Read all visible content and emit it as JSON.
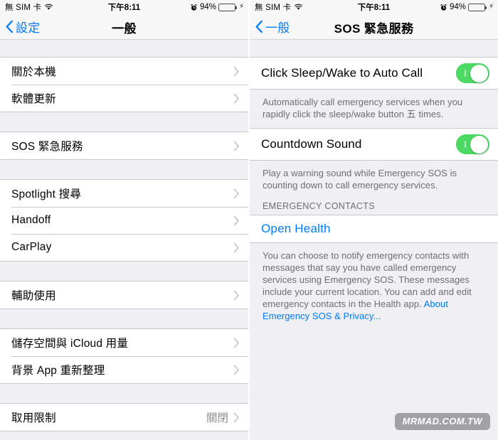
{
  "status_bar": {
    "carrier": "無 SIM 卡",
    "wifi_icon": "wifi-icon",
    "time": "下午8:11",
    "alarm_icon": "alarm-clock-icon",
    "battery_percent": "94%",
    "battery_level": 94,
    "charging_icon": "lightning-bolt-icon",
    "battery_color": "#4cd964"
  },
  "left_screen": {
    "nav": {
      "back_icon": "chevron-left-icon",
      "back_label": "設定",
      "title": "一般"
    },
    "groups": [
      {
        "rows": [
          {
            "label": "關於本機",
            "value": "",
            "accessory": "chevron-right-icon"
          },
          {
            "label": "軟體更新",
            "value": "",
            "accessory": "chevron-right-icon"
          }
        ]
      },
      {
        "rows": [
          {
            "label": "SOS 緊急服務",
            "value": "",
            "accessory": "chevron-right-icon"
          }
        ]
      },
      {
        "rows": [
          {
            "label": "Spotlight 搜尋",
            "value": "",
            "accessory": "chevron-right-icon"
          },
          {
            "label": "Handoff",
            "value": "",
            "accessory": "chevron-right-icon"
          },
          {
            "label": "CarPlay",
            "value": "",
            "accessory": "chevron-right-icon"
          }
        ]
      },
      {
        "rows": [
          {
            "label": "輔助使用",
            "value": "",
            "accessory": "chevron-right-icon"
          }
        ]
      },
      {
        "rows": [
          {
            "label": "儲存空間與 iCloud 用量",
            "value": "",
            "accessory": "chevron-right-icon"
          },
          {
            "label": "背景 App 重新整理",
            "value": "",
            "accessory": "chevron-right-icon"
          }
        ]
      },
      {
        "rows": [
          {
            "label": "取用限制",
            "value": "關閉",
            "accessory": "chevron-right-icon"
          }
        ]
      }
    ]
  },
  "right_screen": {
    "nav": {
      "back_icon": "chevron-left-icon",
      "back_label": "一般",
      "title": "SOS 緊急服務"
    },
    "toggle_auto_call": {
      "label": "Click Sleep/Wake to Auto Call",
      "state": "on",
      "color": "#4cd964"
    },
    "footer_auto_call": "Automatically call emergency services when you rapidly click the sleep/wake button 五 times.",
    "toggle_countdown": {
      "label": "Countdown Sound",
      "state": "on",
      "color": "#4cd964"
    },
    "footer_countdown": "Play a warning sound while Emergency SOS is counting down to call emergency services.",
    "section_header_contacts": "EMERGENCY CONTACTS",
    "open_health_label": "Open Health",
    "footer_contacts_text": "You can choose to notify emergency contacts with messages that say you have called emergency services using Emergency SOS. These messages include your current location. You can add and edit emergency contacts in the Health app. ",
    "footer_contacts_link": "About Emergency SOS & Privacy..."
  },
  "watermark": {
    "text": "MRMAD.COM.TW"
  }
}
